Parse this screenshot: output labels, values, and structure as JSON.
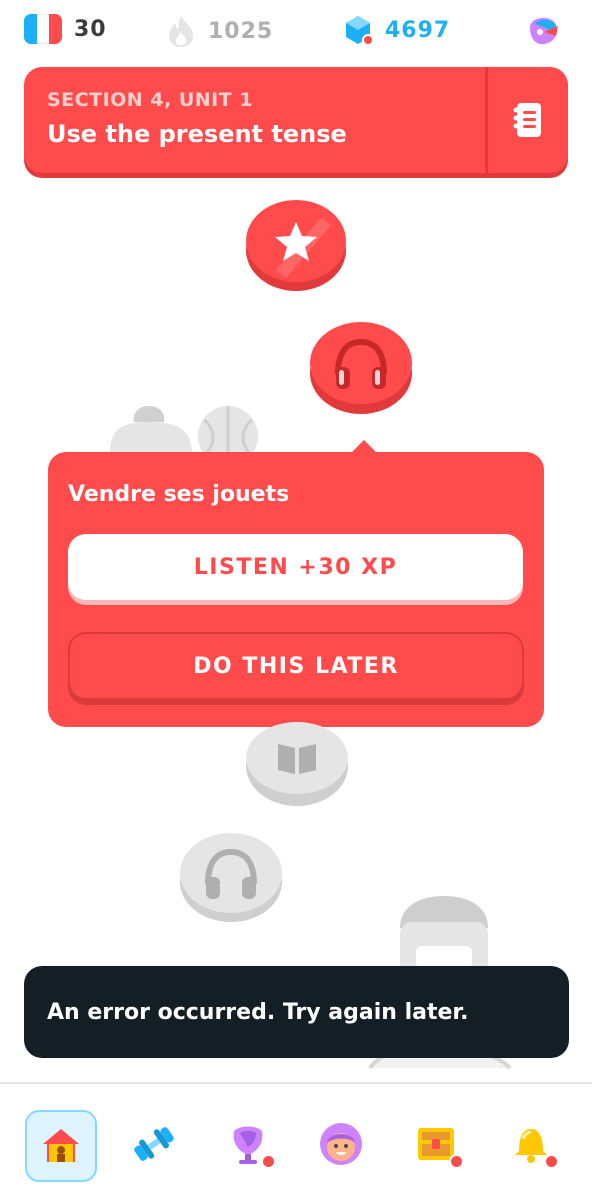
{
  "topbar": {
    "course_flag_icon": "france-flag-icon",
    "streak": {
      "label": "30",
      "icon": "flame-icon"
    },
    "xp": {
      "label": "1025",
      "icon": "drop-icon"
    },
    "gems": {
      "label": "4697",
      "icon": "gem-icon"
    },
    "super_icon": "super-owl-icon"
  },
  "unit_header": {
    "section": "SECTION 4, UNIT 1",
    "title": "Use the present tense",
    "guide_icon": "notebook-icon"
  },
  "popup": {
    "title": "Vendre ses jouets",
    "primary_button": "LISTEN +30 XP",
    "secondary_button": "DO THIS LATER"
  },
  "toast": {
    "message": "An error occurred. Try again later."
  },
  "nav": {
    "items": [
      {
        "icon": "home-icon",
        "active": true
      },
      {
        "icon": "dumbbell-icon",
        "active": false
      },
      {
        "icon": "shield-icon",
        "active": false,
        "badge": true
      },
      {
        "icon": "profile-avatar-icon",
        "active": false
      },
      {
        "icon": "treasure-chest-icon",
        "active": false,
        "badge": true
      },
      {
        "icon": "bell-icon",
        "active": false,
        "badge": true
      }
    ]
  },
  "colors": {
    "accent_red": "#ff4b4b",
    "accent_red_dark": "#e23a3a",
    "gem_blue": "#1cb0f6",
    "gray_node": "#e5e5e5",
    "toast_bg": "#131f24"
  }
}
